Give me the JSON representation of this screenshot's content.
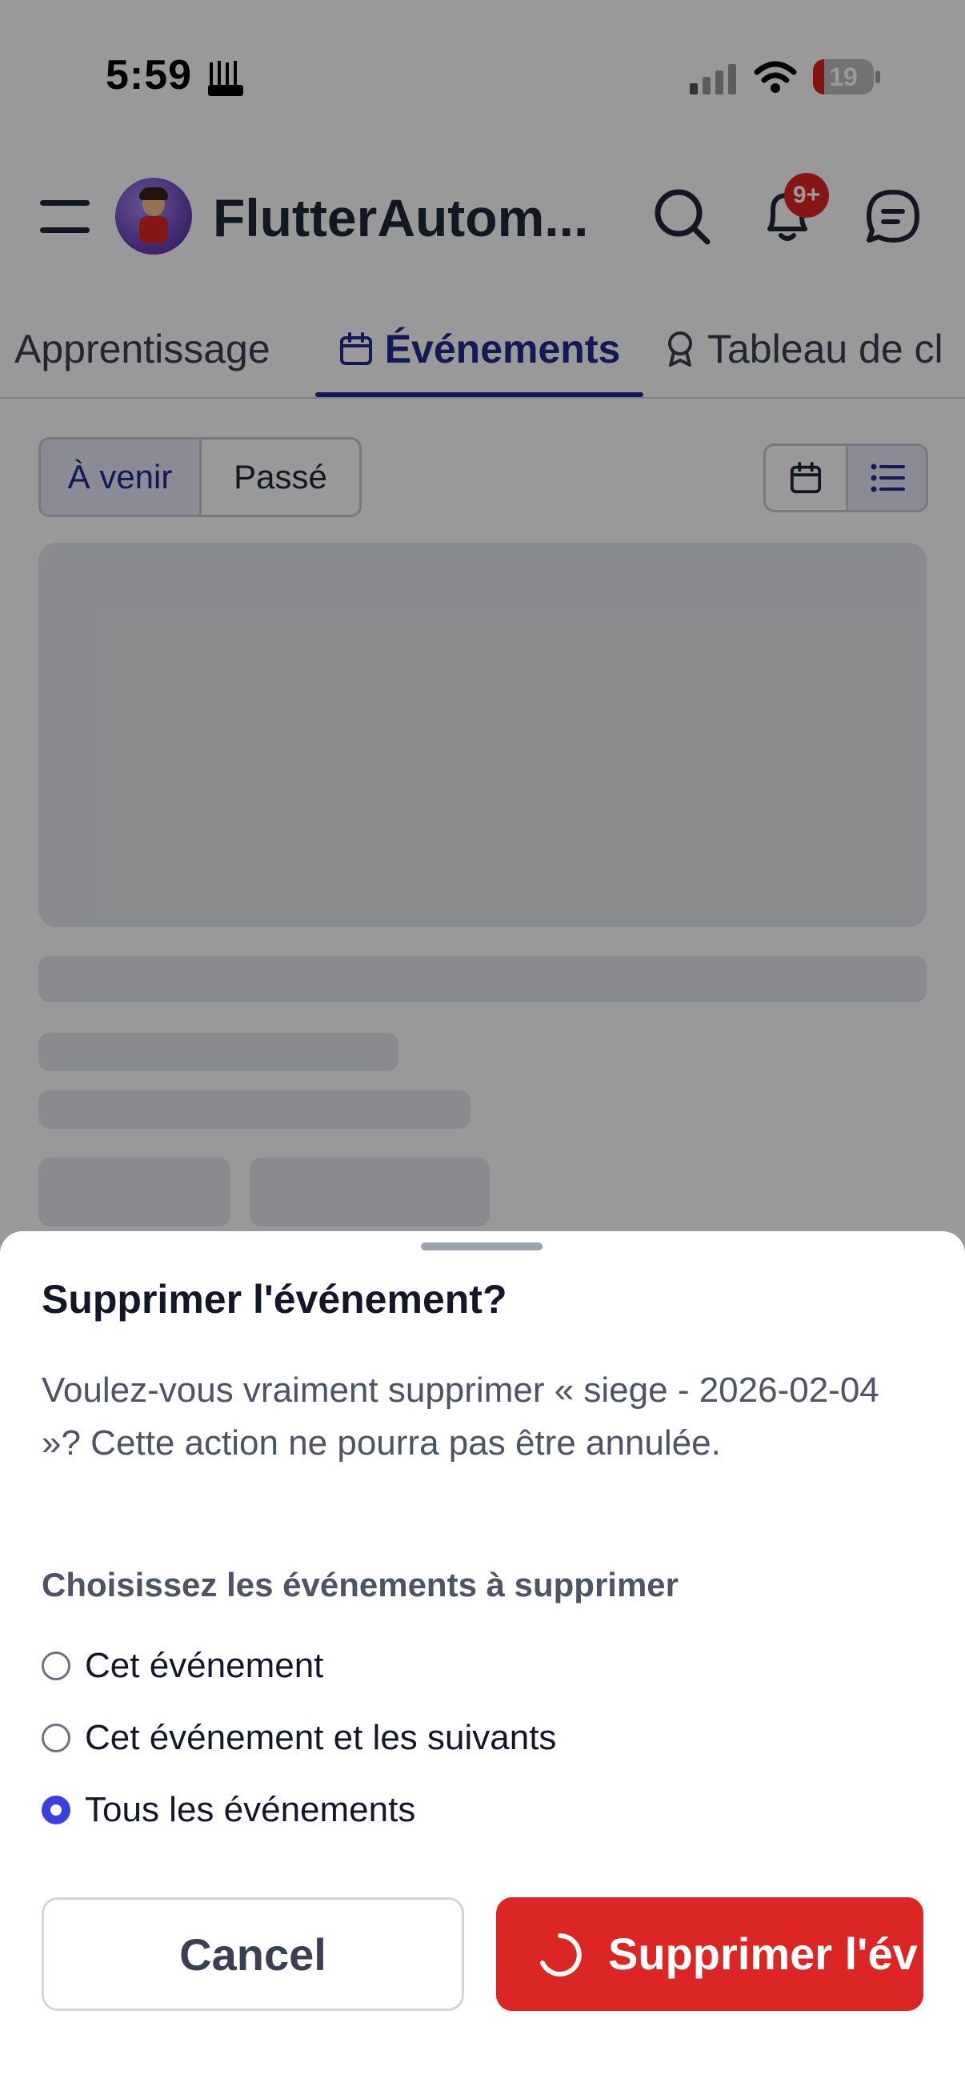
{
  "status_bar": {
    "time": "5:59",
    "battery_level": 19,
    "battery_text": "19"
  },
  "app_bar": {
    "title": "FlutterAutom...",
    "notification_badge": "9+",
    "icons": [
      "menu-icon",
      "avatar",
      "search-icon",
      "bell-icon",
      "chat-icon"
    ]
  },
  "tabs": [
    {
      "label": "Apprentissage",
      "active": false
    },
    {
      "label": "Événements",
      "active": true,
      "icon": "calendar-icon"
    },
    {
      "label": "Tableau de cl",
      "active": false,
      "icon": "award-icon"
    }
  ],
  "filter": {
    "segments": [
      "À venir",
      "Passé"
    ],
    "selected": "À venir",
    "view_modes": [
      "calendar-icon",
      "list-icon"
    ],
    "selected_view": "list"
  },
  "dialog": {
    "title": "Supprimer l'événement?",
    "message": "Voulez-vous vraiment supprimer « siege - 2026-02-04 »? Cette action ne pourra pas être annulée.",
    "options_heading": "Choisissez les événements à supprimer",
    "options": [
      {
        "label": "Cet événement",
        "checked": false
      },
      {
        "label": "Cet événement et les suivants",
        "checked": false
      },
      {
        "label": "Tous les événements",
        "checked": true
      }
    ],
    "cancel_label": "Cancel",
    "delete_label": "Supprimer l'év",
    "colors": {
      "danger": "#dc2626",
      "radio_selected": "#3b3fe0",
      "accent": "#1e2a8a"
    }
  }
}
